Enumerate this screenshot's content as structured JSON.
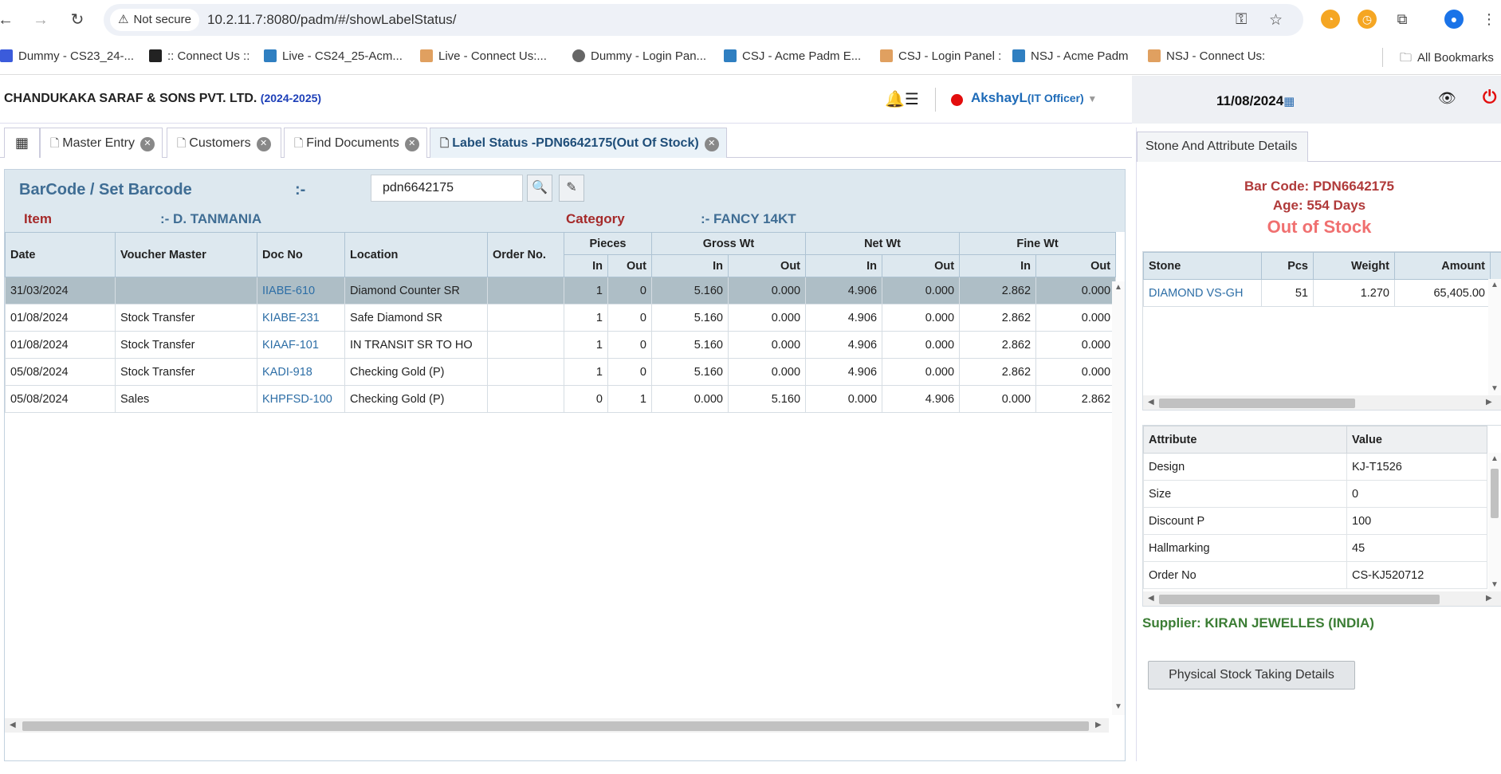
{
  "browser": {
    "security_label": "Not secure",
    "url": "10.2.11.7:8080/padm/#/showLabelStatus/",
    "bookmarks": [
      {
        "label": "Dummy  - CS23_24-...",
        "icon_color": "#3b5bdb"
      },
      {
        "label": ":: Connect Us ::",
        "icon_color": "#222222"
      },
      {
        "label": "Live - CS24_25-Acm...",
        "icon_color": "#2f7fc1"
      },
      {
        "label": "Live - Connect Us:...",
        "icon_color": "#e0a060"
      },
      {
        "label": "Dummy - Login Pan...",
        "icon_color": "#666666"
      },
      {
        "label": "CSJ - Acme Padm E...",
        "icon_color": "#2f7fc1"
      },
      {
        "label": "CSJ - Login Panel :",
        "icon_color": "#e0a060"
      },
      {
        "label": "NSJ - Acme Padm",
        "icon_color": "#2f7fc1"
      },
      {
        "label": "NSJ - Connect Us:",
        "icon_color": "#e0a060"
      }
    ],
    "all_bookmarks": "All Bookmarks"
  },
  "header": {
    "company": "CHANDUKAKA SARAF & SONS PVT. LTD.",
    "year": "(2024-2025)",
    "user_name": "AkshayL",
    "user_role": "(IT Officer)",
    "date": "11/08/2024"
  },
  "tabs": [
    {
      "label": "Master Entry",
      "active": false
    },
    {
      "label": "Customers",
      "active": false
    },
    {
      "label": "Find Documents",
      "active": false
    },
    {
      "label": "Label Status -PDN6642175(Out Of Stock)",
      "active": true
    }
  ],
  "barcode": {
    "label": "BarCode / Set Barcode",
    "separator": ":-",
    "value": "pdn6642175"
  },
  "item": {
    "label": "Item",
    "value": ":- D. TANMANIA"
  },
  "category": {
    "label": "Category",
    "value": ":- FANCY 14KT"
  },
  "table": {
    "headers": {
      "date": "Date",
      "voucher": "Voucher Master",
      "doc_no": "Doc No",
      "location": "Location",
      "order_no": "Order No.",
      "pieces": "Pieces",
      "gross": "Gross Wt",
      "net": "Net Wt",
      "fine": "Fine Wt",
      "in": "In",
      "out": "Out"
    },
    "rows": [
      {
        "date": "31/03/2024",
        "voucher": "",
        "doc_no": "IIABE-610",
        "location": "Diamond Counter SR",
        "order_no": "",
        "pcs_in": "1",
        "pcs_out": "0",
        "gross_in": "5.160",
        "gross_out": "0.000",
        "net_in": "4.906",
        "net_out": "0.000",
        "fine_in": "2.862",
        "fine_out": "0.000"
      },
      {
        "date": "01/08/2024",
        "voucher": "Stock Transfer",
        "doc_no": "KIABE-231",
        "location": "Safe Diamond SR",
        "order_no": "",
        "pcs_in": "1",
        "pcs_out": "0",
        "gross_in": "5.160",
        "gross_out": "0.000",
        "net_in": "4.906",
        "net_out": "0.000",
        "fine_in": "2.862",
        "fine_out": "0.000"
      },
      {
        "date": "01/08/2024",
        "voucher": "Stock Transfer",
        "doc_no": "KIAAF-101",
        "location": "IN TRANSIT SR TO HO",
        "order_no": "",
        "pcs_in": "1",
        "pcs_out": "0",
        "gross_in": "5.160",
        "gross_out": "0.000",
        "net_in": "4.906",
        "net_out": "0.000",
        "fine_in": "2.862",
        "fine_out": "0.000"
      },
      {
        "date": "05/08/2024",
        "voucher": "Stock Transfer",
        "doc_no": "KADI-918",
        "location": "Checking Gold (P)",
        "order_no": "",
        "pcs_in": "1",
        "pcs_out": "0",
        "gross_in": "5.160",
        "gross_out": "0.000",
        "net_in": "4.906",
        "net_out": "0.000",
        "fine_in": "2.862",
        "fine_out": "0.000"
      },
      {
        "date": "05/08/2024",
        "voucher": "Sales",
        "doc_no": "KHPFSD-100",
        "location": "Checking Gold (P)",
        "order_no": "",
        "pcs_in": "0",
        "pcs_out": "1",
        "gross_in": "0.000",
        "gross_out": "5.160",
        "net_in": "0.000",
        "net_out": "4.906",
        "fine_in": "0.000",
        "fine_out": "2.862"
      }
    ]
  },
  "details": {
    "tab_label": "Stone And Attribute Details",
    "bar_code": "Bar Code: PDN6642175",
    "age": "Age: 554 Days",
    "stock_status": "Out of Stock",
    "stone_headers": {
      "stone": "Stone",
      "pcs": "Pcs",
      "weight": "Weight",
      "amount": "Amount"
    },
    "stones": [
      {
        "stone": "DIAMOND VS-GH",
        "pcs": "51",
        "weight": "1.270",
        "amount": "65,405.00"
      }
    ],
    "attr_headers": {
      "attribute": "Attribute",
      "value": "Value"
    },
    "attributes": [
      {
        "attribute": "Design",
        "value": "KJ-T1526"
      },
      {
        "attribute": "Size",
        "value": "0"
      },
      {
        "attribute": "Discount P",
        "value": "100"
      },
      {
        "attribute": "Hallmarking",
        "value": "45"
      },
      {
        "attribute": "Order No",
        "value": "CS-KJ520712"
      }
    ],
    "supplier": "Supplier: KIRAN JEWELLES (INDIA)",
    "pst_button": "Physical Stock Taking Details"
  }
}
